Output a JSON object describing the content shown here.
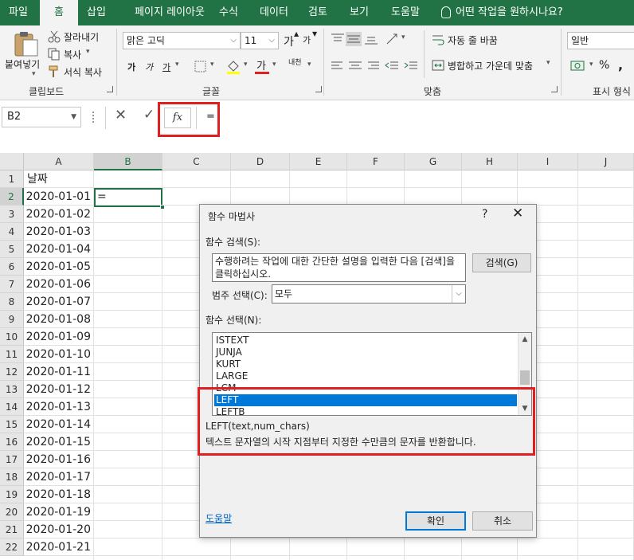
{
  "ribbon_tabs": [
    "파일",
    "홈",
    "삽입",
    "페이지 레이아웃",
    "수식",
    "데이터",
    "검토",
    "보기",
    "도움말"
  ],
  "active_tab": "홈",
  "tell_me": "어떤 작업을 원하시나요?",
  "clipboard": {
    "paste_label": "붙여넣기",
    "cut_label": "잘라내기",
    "copy_label": "복사",
    "format_painter_label": "서식 복사",
    "group_label": "클립보드"
  },
  "font": {
    "font_name": "맑은 고딕",
    "font_size": "11",
    "grow_label": "가",
    "shrink_label": "가",
    "bold_label": "가",
    "italic_label": "가",
    "underline_label": "가",
    "font_color_label": "가",
    "phonetic_label": "내천",
    "group_label": "글꼴"
  },
  "alignment": {
    "wrap_text_label": "자동 줄 바꿈",
    "merge_center_label": "병합하고 가운데 맞춤",
    "group_label": "맞춤"
  },
  "number": {
    "format_value": "일반",
    "percent_label": "%",
    "comma_label": ",",
    "group_label": "표시 형식"
  },
  "formula_bar": {
    "name_box": "B2",
    "cancel_symbol": "✕",
    "enter_symbol": "✓",
    "fx_label": "fx",
    "formula": "="
  },
  "sheet": {
    "columns": [
      "A",
      "B",
      "C",
      "D",
      "E",
      "F",
      "G",
      "H",
      "I",
      "J"
    ],
    "selected_column": "B",
    "rows": [
      "1",
      "2",
      "3",
      "4",
      "5",
      "6",
      "7",
      "8",
      "9",
      "10",
      "11",
      "12",
      "13",
      "14",
      "15",
      "16",
      "17",
      "18",
      "19",
      "20",
      "21",
      "22"
    ],
    "selected_row": "2",
    "a1": "날짜",
    "dates": [
      "2020-01-01",
      "2020-01-02",
      "2020-01-03",
      "2020-01-04",
      "2020-01-05",
      "2020-01-06",
      "2020-01-07",
      "2020-01-08",
      "2020-01-09",
      "2020-01-10",
      "2020-01-11",
      "2020-01-12",
      "2020-01-13",
      "2020-01-14",
      "2020-01-15",
      "2020-01-16",
      "2020-01-17",
      "2020-01-18",
      "2020-01-19",
      "2020-01-20",
      "2020-01-21"
    ],
    "b2": "="
  },
  "dialog": {
    "title": "함수 마법사",
    "help_symbol": "?",
    "close_symbol": "✕",
    "search_label": "함수 검색(S):",
    "search_text": "수행하려는 작업에 대한 간단한 설명을 입력한 다음 [검색]을 클릭하십시오.",
    "search_button": "검색(G)",
    "category_label": "범주 선택(C):",
    "category_value": "모두",
    "function_label": "함수 선택(N):",
    "functions": [
      "ISTEXT",
      "JUNJA",
      "KURT",
      "LARGE",
      "LCM",
      "LEFT",
      "LEFTB"
    ],
    "selected_function": "LEFT",
    "syntax": "LEFT(text,num_chars)",
    "description": "텍스트 문자열의 시작 지점부터 지정한 수만큼의 문자를 반환합니다.",
    "help_link": "도움말",
    "ok_button": "확인",
    "cancel_button": "취소"
  },
  "colors": {
    "excel_green": "#217346",
    "highlight_red": "#e02020",
    "selection_blue": "#0078d7"
  }
}
